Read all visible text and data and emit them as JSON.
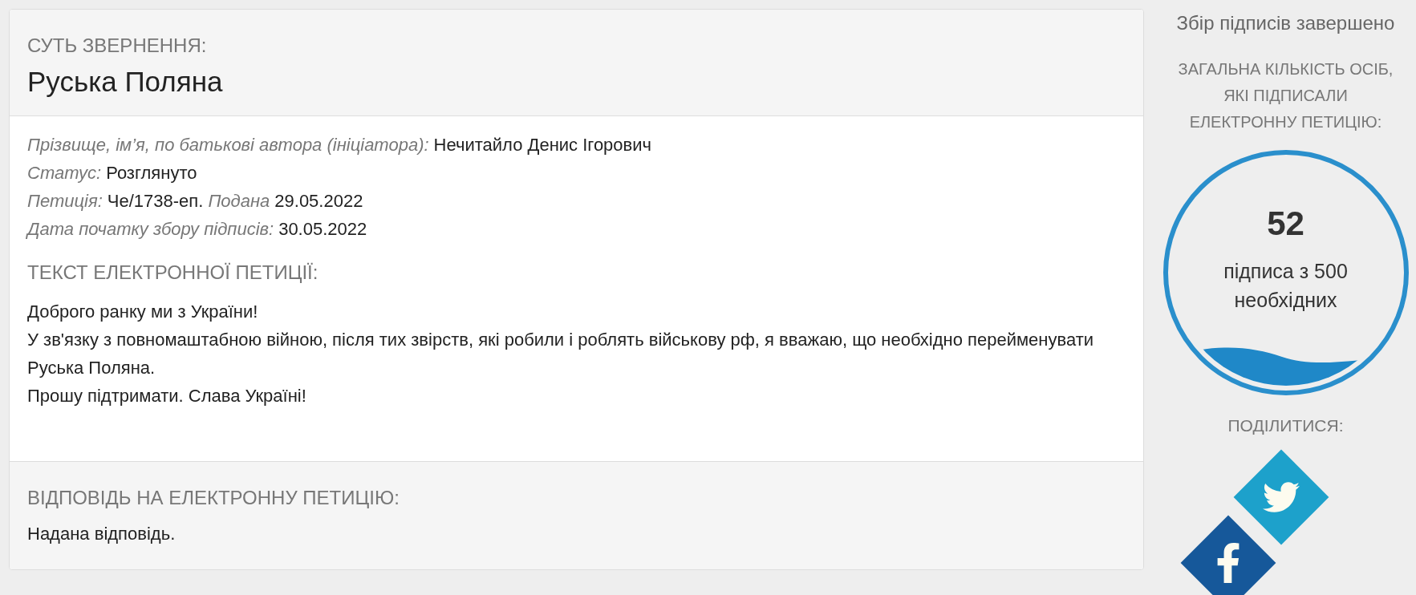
{
  "petition": {
    "subject_label": "СУТЬ ЗВЕРНЕННЯ:",
    "title": "Руська Поляна",
    "details": [
      [
        {
          "label": "Прізвище, ім’я, по батькові автора (ініціатора):",
          "value": "Нечитайло Денис Ігорович"
        }
      ],
      [
        {
          "label": "Статус:",
          "value": "Розглянуто"
        }
      ],
      [
        {
          "label": "Петиція:",
          "value": "Че/1738-еп."
        },
        {
          "label": "Подана",
          "value": "29.05.2022"
        }
      ],
      [
        {
          "label": "Дата початку збору підписів:",
          "value": "30.05.2022"
        }
      ]
    ],
    "text_heading": "ТЕКСТ ЕЛЕКТРОННОЇ ПЕТИЦІЇ:",
    "text_lines": [
      "Доброго ранку ми з України!",
      "У зв'язку з повномаштабною війною, після тих звірств, які робили і роблять військову рф, я вважаю, що необхідно перейменувати",
      "Руська Поляна.",
      "Прошу підтримати. Слава Україні!"
    ],
    "answer_heading": "ВІДПОВІДЬ НА ЕЛЕКТРОННУ ПЕТИЦІЮ:",
    "answer_text": "Надана відповідь."
  },
  "sidebar": {
    "status": "Збір підписів завершено",
    "count_heading_lines": [
      "ЗАГАЛЬНА КІЛЬКІСТЬ ОСІБ,",
      "ЯКІ ПІДПИСАЛИ",
      "ЕЛЕКТРОННУ ПЕТИЦІЮ:"
    ],
    "signatures": {
      "count": "52",
      "caption_lines": [
        "підписа з 500",
        "необхідних"
      ]
    },
    "share_label": "ПОДІЛИТИСЯ:",
    "share_buttons": [
      {
        "kind": "twitter"
      },
      {
        "kind": "facebook"
      }
    ]
  }
}
